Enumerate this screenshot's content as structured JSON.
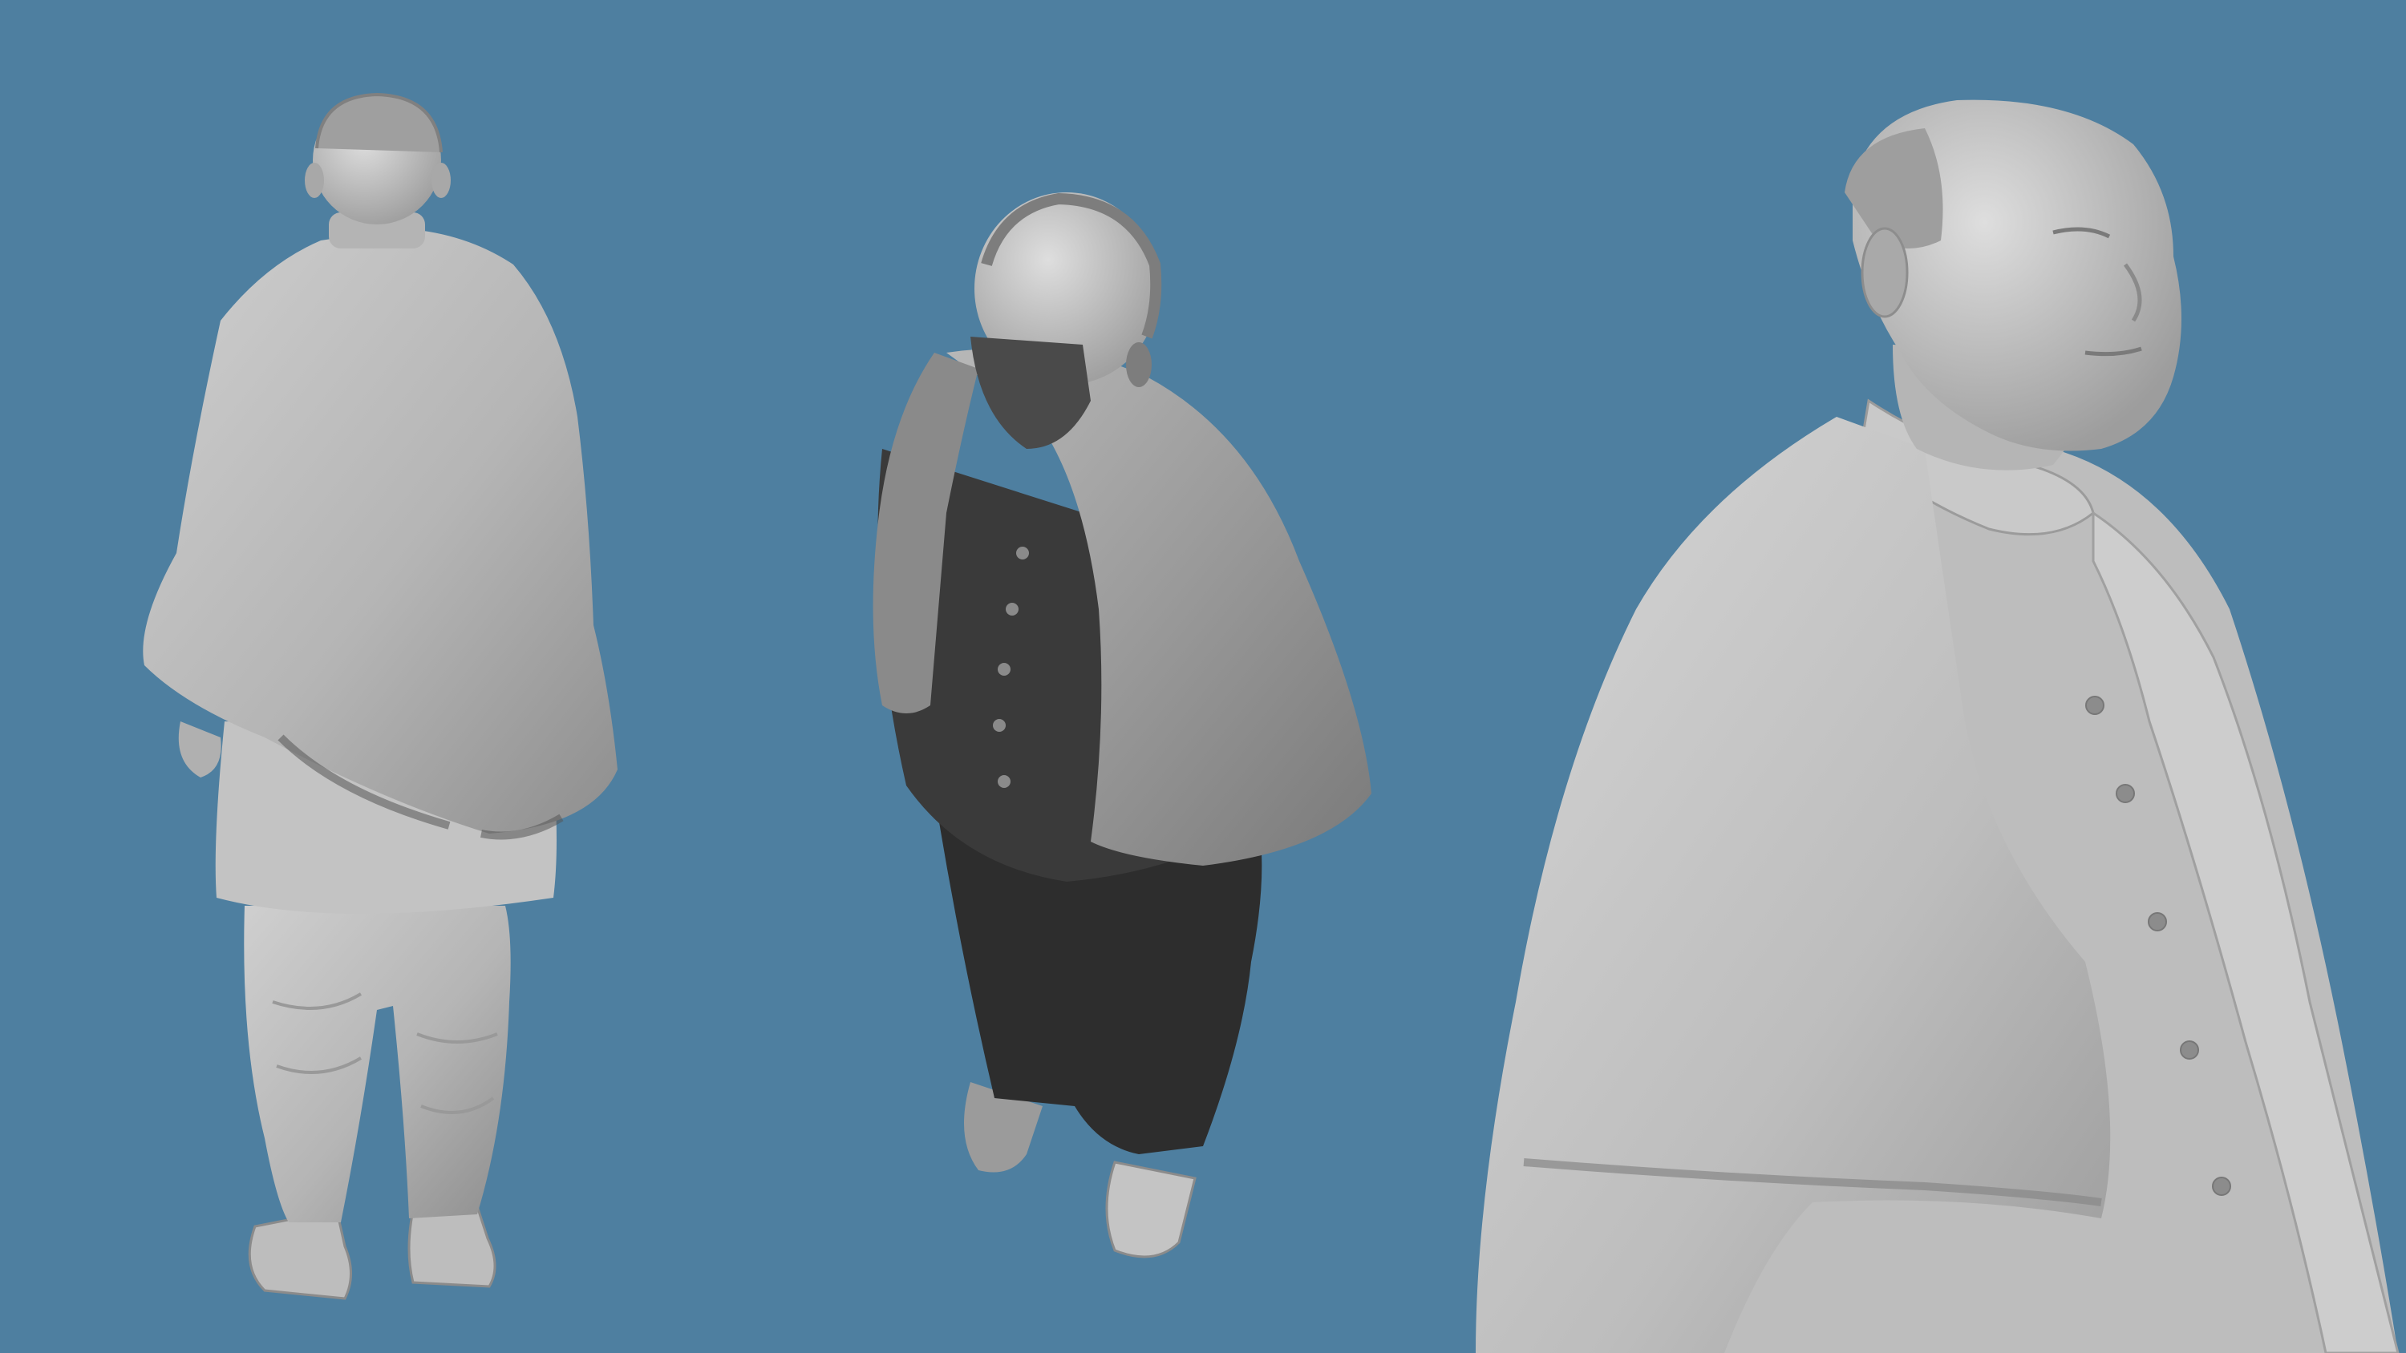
{
  "scene": {
    "background_color": "#4e7fa0",
    "subject_color": "#a9a9a9",
    "views": [
      {
        "id": "back-view"
      },
      {
        "id": "top-view"
      },
      {
        "id": "front-closeup-view"
      }
    ]
  }
}
